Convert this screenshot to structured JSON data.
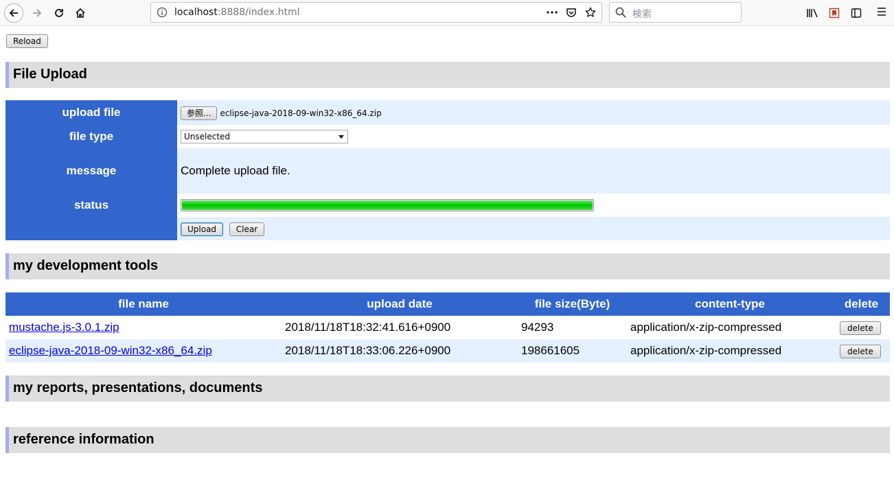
{
  "browser": {
    "url_host": "localhost",
    "url_rest": ":8888/index.html",
    "search_placeholder": "検索"
  },
  "reload_label": "Reload",
  "sections": {
    "file_upload": "File Upload",
    "dev_tools": "my development tools",
    "reports": "my reports, presentations, documents",
    "reference": "reference information"
  },
  "upload_form": {
    "upload_file_label": "upload file",
    "browse_label": "参照...",
    "selected_file": "eclipse-java-2018-09-win32-x86_64.zip",
    "file_type_label": "file type",
    "file_type_value": "Unselected",
    "message_label": "message",
    "message_value": "Complete upload file.",
    "status_label": "status",
    "progress": 1.0,
    "upload_label": "Upload",
    "clear_label": "Clear"
  },
  "files_table": {
    "headers": [
      "file name",
      "upload date",
      "file size(Byte)",
      "content-type",
      "delete"
    ],
    "rows": [
      {
        "name": "mustache.js-3.0.1.zip",
        "date": "2018/11/18T18:32:41.616+0900",
        "size": "94293",
        "type": "application/x-zip-compressed",
        "delete": "delete"
      },
      {
        "name": "eclipse-java-2018-09-win32-x86_64.zip",
        "date": "2018/11/18T18:33:06.226+0900",
        "size": "198661605",
        "type": "application/x-zip-compressed",
        "delete": "delete"
      }
    ]
  }
}
